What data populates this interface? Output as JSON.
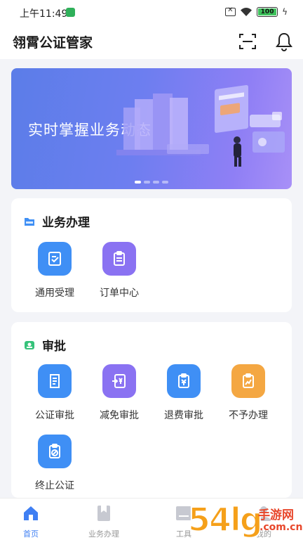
{
  "status_bar": {
    "time": "上午11:49",
    "battery": "100"
  },
  "header": {
    "title": "翎霄公证管家",
    "scan_icon": "scan-icon",
    "bell_icon": "bell-icon"
  },
  "banner": {
    "text": "实时掌握业务动态",
    "active_dot": 1
  },
  "business": {
    "title": "业务办理",
    "items": [
      {
        "label": "通用受理",
        "icon": "form-edit-icon",
        "color": "#3f8ff5"
      },
      {
        "label": "订单中心",
        "icon": "clipboard-list-icon",
        "color": "#8a72f2"
      }
    ]
  },
  "approval": {
    "title": "审批",
    "items": [
      {
        "label": "公证审批",
        "icon": "document-icon",
        "color": "#3f8ff5"
      },
      {
        "label": "减免审批",
        "icon": "yuan-transfer-icon",
        "color": "#8a72f2"
      },
      {
        "label": "退费审批",
        "icon": "yuan-clipboard-icon",
        "color": "#3f8ff5"
      },
      {
        "label": "不予办理",
        "icon": "chart-clipboard-icon",
        "color": "#f4a742"
      },
      {
        "label": "终止公证",
        "icon": "ban-clipboard-icon",
        "color": "#3f8ff5"
      }
    ]
  },
  "tabs": [
    {
      "label": "首页",
      "icon": "home-icon",
      "active": true
    },
    {
      "label": "业务办理",
      "icon": "bookmark-icon",
      "active": false
    },
    {
      "label": "工具",
      "icon": "tools-icon",
      "active": false
    },
    {
      "label": "我的",
      "icon": "user-icon",
      "active": false
    }
  ],
  "watermark": {
    "number": "54lg",
    "name": "手游网",
    "domain": ".com.cn"
  },
  "colors": {
    "accent": "#3f7ff3",
    "purple": "#8a72f2",
    "orange": "#f4a742",
    "background": "#f3f4f8"
  }
}
